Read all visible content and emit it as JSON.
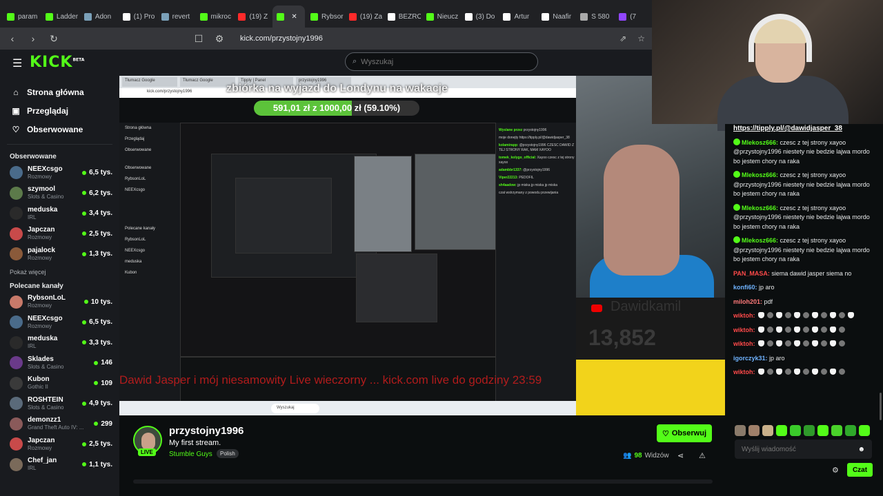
{
  "browser": {
    "tabs": [
      {
        "label": "param",
        "color": "#53fc18"
      },
      {
        "label": "Ladder",
        "color": "#53fc18"
      },
      {
        "label": "Adon",
        "color": "#7aa0b8"
      },
      {
        "label": "(1) Pro",
        "color": "#ffffff"
      },
      {
        "label": "revert",
        "color": "#7aa0b8"
      },
      {
        "label": "mikroc",
        "color": "#53fc18"
      },
      {
        "label": "(19) Z",
        "color": "#ff2a2a"
      },
      {
        "label": "",
        "color": "#53fc18",
        "active": true
      },
      {
        "label": "Rybsor",
        "color": "#53fc18"
      },
      {
        "label": "(19) Za",
        "color": "#ff2a2a"
      },
      {
        "label": "BEZRO",
        "color": "#ffffff"
      },
      {
        "label": "Nieucz",
        "color": "#53fc18"
      },
      {
        "label": "(3) Do",
        "color": "#ffffff"
      },
      {
        "label": "Artur",
        "color": "#ffffff"
      },
      {
        "label": "Naafir",
        "color": "#ffffff"
      },
      {
        "label": "S 580",
        "color": "#aaaaaa"
      },
      {
        "label": "(7",
        "color": "#9146ff"
      }
    ],
    "url": "kick.com/przystojny1996"
  },
  "header": {
    "logo": "KICK",
    "logo_sup": "BETA",
    "search_placeholder": "Wyszukaj"
  },
  "sidebar": {
    "nav": [
      {
        "label": "Strona główna",
        "icon": "home-icon"
      },
      {
        "label": "Przeglądaj",
        "icon": "browse-icon"
      },
      {
        "label": "Obserwowane",
        "icon": "heart-icon"
      }
    ],
    "followed_title": "Obserwowane",
    "followed": [
      {
        "name": "NEEXcsgo",
        "category": "Rozmowy",
        "viewers": "6,5 tys.",
        "color": "#4a6b8a"
      },
      {
        "name": "szymool",
        "category": "Slots & Casino",
        "viewers": "6,2 tys.",
        "color": "#5c7a4a"
      },
      {
        "name": "meduska",
        "category": "IRL",
        "viewers": "3,4 tys.",
        "color": "#2a2a2a"
      },
      {
        "name": "Japczan",
        "category": "Rozmowy",
        "viewers": "2,5 tys.",
        "color": "#c84a4a"
      },
      {
        "name": "pajalock",
        "category": "Rozmowy",
        "viewers": "1,3 tys.",
        "color": "#8a5a3a"
      }
    ],
    "show_more": "Pokaż więcej",
    "recommended_title": "Polecane kanały",
    "recommended": [
      {
        "name": "RybsonLoL",
        "category": "Rozmowy",
        "viewers": "10 tys.",
        "color": "#c87a6a"
      },
      {
        "name": "NEEXcsgo",
        "category": "Rozmowy",
        "viewers": "6,5 tys.",
        "color": "#4a6b8a"
      },
      {
        "name": "meduska",
        "category": "IRL",
        "viewers": "3,3 tys.",
        "color": "#2a2a2a"
      },
      {
        "name": "Sklades",
        "category": "Slots & Casino",
        "viewers": "146",
        "color": "#6a3a8a"
      },
      {
        "name": "Kubon",
        "category": "Gothic II",
        "viewers": "109",
        "color": "#3a3a3a"
      },
      {
        "name": "ROSHTEIN",
        "category": "Slots & Casino",
        "viewers": "4,9 tys.",
        "color": "#5a6a7a"
      },
      {
        "name": "demonzz1",
        "category": "Grand Theft Auto IV: ...",
        "viewers": "299",
        "color": "#8a5a5a"
      },
      {
        "name": "Japczan",
        "category": "Rozmowy",
        "viewers": "2,5 tys.",
        "color": "#c84a4a"
      },
      {
        "name": "Chef_jan",
        "category": "IRL",
        "viewers": "1,1 tys.",
        "color": "#7a6a5a"
      }
    ]
  },
  "player": {
    "overlay_title": "zbiórka na wyjazd do Londynu na wakacje",
    "goal_text": "591,01 zł z 1000,00 zł (59.10%)",
    "goal_progress": 59.1,
    "ticker": "Dawid Jasper i mój niesamowity Live wieczorny ... kick.com live do godziny 23:59",
    "yt_channel": "Dawidkamil",
    "yt_count": "13,852",
    "inner_search": "Wyszukaj",
    "inner_chat_lines": [
      {
        "user": "Wyslane przez",
        "text": "przystojny1996"
      },
      {
        "user": "",
        "text": "moje donejty https://tipply.pl/@dawidjasper_38"
      },
      {
        "user": "kolamirapp:",
        "text": "@przystojny1996 CZESC DAWID Z TEJ STRONY RAK, MAM XAYOO"
      },
      {
        "user": "tomek_kolygo_official:",
        "text": "Xayoo czesc z tej strony xayoo"
      },
      {
        "user": "adambbr1337:",
        "text": "@przystojny1996"
      },
      {
        "user": "Viper22213:",
        "text": "PEDOFIL"
      },
      {
        "user": "sh4aadow:",
        "text": "jp miska jp miska jp miska"
      },
      {
        "user": "",
        "text": "czat wstrzymany z powodu przewijania"
      }
    ]
  },
  "channel": {
    "name": "przystojny1996",
    "title": "My first stream.",
    "category": "Stumble Guys",
    "language": "Polish",
    "live_badge": "LIVE",
    "follow_label": "Obserwuj",
    "viewers_count": "98",
    "viewers_label": "Widzów"
  },
  "chat": {
    "link": "https://tipply.pl/@dawidjasper_38",
    "messages": [
      {
        "user": "Mlekosz666:",
        "color": "#53fc18",
        "badge": true,
        "text": "czesc z tej strony xayoo @przystojny1996 niestety nie bedzie lajwa mordo bo jestem chory na raka"
      },
      {
        "user": "Mlekosz666:",
        "color": "#53fc18",
        "badge": true,
        "text": "czesc z tej strony xayoo @przystojny1996 niestety nie bedzie lajwa mordo bo jestem chory na raka"
      },
      {
        "user": "Mlekosz666:",
        "color": "#53fc18",
        "badge": true,
        "text": "czesc z tej strony xayoo @przystojny1996 niestety nie bedzie lajwa mordo bo jestem chory na raka"
      },
      {
        "user": "Mlekosz666:",
        "color": "#53fc18",
        "badge": true,
        "text": "czesc z tej strony xayoo @przystojny1996 niestety nie bedzie lajwa mordo bo jestem chory na raka"
      },
      {
        "user": "PAN_MASA:",
        "color": "#ff4a4a",
        "badge": false,
        "text": "siema dawid jasper siema no"
      },
      {
        "user": "konfi60:",
        "color": "#6fb3ff",
        "badge": false,
        "text": "jp aro"
      },
      {
        "user": "miloh201:",
        "color": "#ff7a7a",
        "badge": false,
        "text": "pdf"
      },
      {
        "user": "wiktoh:",
        "color": "#ff4a4a",
        "badge": false,
        "text": "",
        "emotes": 11
      },
      {
        "user": "wiktoh:",
        "color": "#ff4a4a",
        "badge": false,
        "text": "",
        "emotes": 10
      },
      {
        "user": "wiktoh:",
        "color": "#ff4a4a",
        "badge": false,
        "text": "",
        "emotes": 10
      },
      {
        "user": "igorczyk31:",
        "color": "#6fb3ff",
        "badge": false,
        "text": "jp aro"
      },
      {
        "user": "wiktoh:",
        "color": "#ff4a4a",
        "badge": false,
        "text": "",
        "emotes": 10
      }
    ],
    "input_placeholder": "Wyślij wiadomość",
    "send_label": "Czat"
  }
}
